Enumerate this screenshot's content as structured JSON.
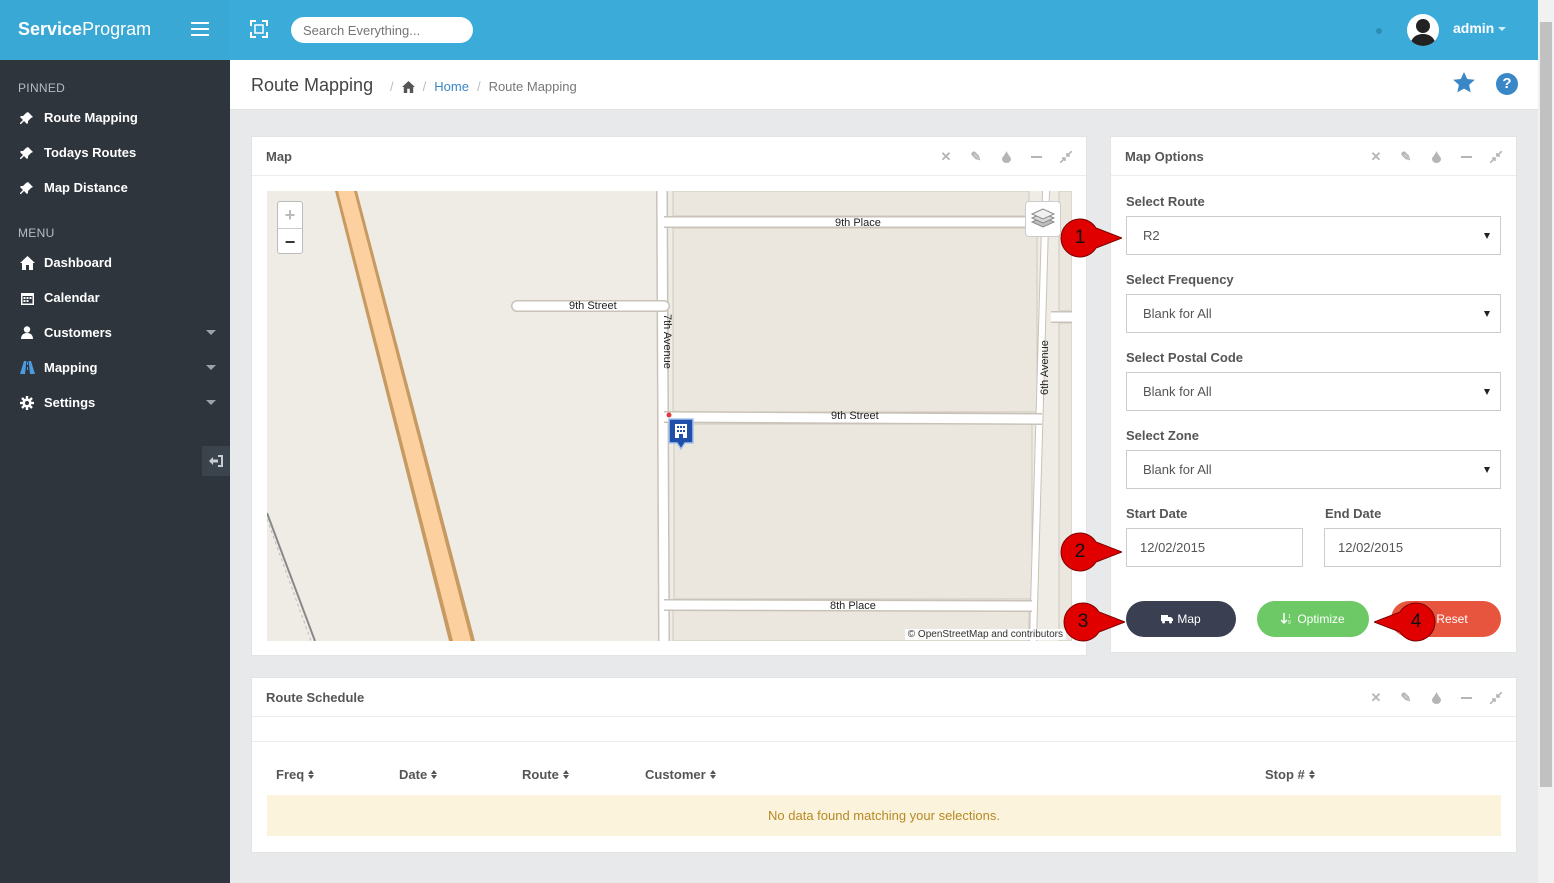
{
  "app": {
    "brand_bold": "Service",
    "brand_light": "Program"
  },
  "topbar": {
    "search_placeholder": "Search Everything...",
    "user": "admin"
  },
  "sidebar": {
    "pinned_heading": "PINNED",
    "pinned": [
      {
        "label": "Route Mapping",
        "icon": "pin-icon"
      },
      {
        "label": "Todays Routes",
        "icon": "pin-icon"
      },
      {
        "label": "Map Distance",
        "icon": "pin-icon"
      }
    ],
    "menu_heading": "MENU",
    "menu": [
      {
        "label": "Dashboard",
        "icon": "home-icon"
      },
      {
        "label": "Calendar",
        "icon": "calendar-icon"
      },
      {
        "label": "Customers",
        "icon": "user-icon"
      },
      {
        "label": "Mapping",
        "icon": "road-icon"
      },
      {
        "label": "Settings",
        "icon": "gear-icon"
      }
    ]
  },
  "header": {
    "title": "Route Mapping",
    "breadcrumb": {
      "home": "Home",
      "current": "Route Mapping"
    }
  },
  "map_panel": {
    "title": "Map",
    "attribution": "© OpenStreetMap and contributors",
    "zoom_in": "+",
    "zoom_out": "−",
    "streets": {
      "s1": "9th Place",
      "s2": "9th Street",
      "s3": "7th Avenue",
      "s4": "6th Avenue",
      "s5": "9th Street",
      "s6": "8th Place"
    }
  },
  "options_panel": {
    "title": "Map Options",
    "route_label": "Select Route",
    "route_value": "R2",
    "frequency_label": "Select Frequency",
    "frequency_value": "Blank for All",
    "postal_label": "Select Postal Code",
    "postal_value": "Blank for All",
    "zone_label": "Select Zone",
    "zone_value": "Blank for All",
    "start_label": "Start Date",
    "start_value": "12/02/2015",
    "end_label": "End Date",
    "end_value": "12/02/2015",
    "map_btn": "Map",
    "optimize_btn": "Optimize",
    "reset_btn": "Reset"
  },
  "schedule_panel": {
    "title": "Route Schedule",
    "columns": [
      "Freq",
      "Date",
      "Route",
      "Customer",
      "Stop #"
    ],
    "empty_message": "No data found matching your selections."
  },
  "callouts": [
    "1",
    "2",
    "3",
    "4"
  ],
  "colors": {
    "topbar": "#3bacd9",
    "sidebar": "#2e353d",
    "map_button": "#3a3f51",
    "optimize_button": "#6cc965",
    "reset_button": "#e8553e",
    "callout": "#e00000",
    "link": "#3a87c8"
  }
}
